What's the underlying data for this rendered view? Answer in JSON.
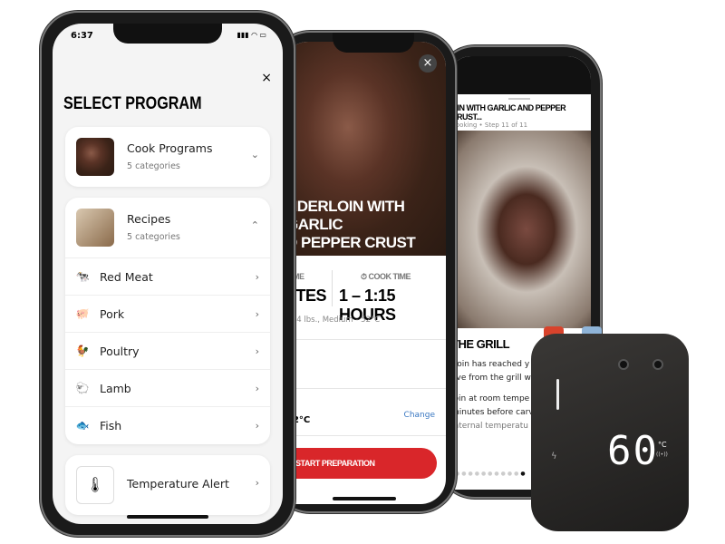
{
  "left_phone": {
    "status_time": "6:37",
    "status_icons": "▮▮▮ ◠ ▭",
    "close": "×",
    "title": "SELECT PROGRAM",
    "cook_programs": {
      "title": "Cook Programs",
      "subtitle": "5 categories"
    },
    "recipes": {
      "title": "Recipes",
      "subtitle": "5 categories",
      "items": [
        {
          "label": "Red Meat",
          "icon": "cow-icon"
        },
        {
          "label": "Pork",
          "icon": "pig-icon"
        },
        {
          "label": "Poultry",
          "icon": "chicken-icon"
        },
        {
          "label": "Lamb",
          "icon": "lamb-icon"
        },
        {
          "label": "Fish",
          "icon": "fish-icon"
        }
      ]
    },
    "temperature_alert": {
      "title": "Temperature Alert"
    }
  },
  "middle_phone": {
    "close": "×",
    "recipe_title_line1": "NDERLOIN WITH GARLIC",
    "recipe_title_line2": "D PEPPER CRUST",
    "prep_label": "TIME",
    "prep_value": "UTES",
    "cook_label": "COOK TIME",
    "cook_value": "1 – 1:15 HOURS",
    "details": "½-4 lbs., Medium -  52°C",
    "target_temp": "52°C",
    "change_link": "Change",
    "start_button": "START PREPARATION",
    "accent": "#d9262a",
    "link_color": "#3a78c2"
  },
  "right_phone": {
    "header_title": "OIN WITH GARLIC AND PEPPER CRUST...",
    "header_sub": "Cooking • Step 11 of 11",
    "step_title": "THE GRILL",
    "step_text1": "rloin has reached y",
    "step_text2": "ove from the grill wi",
    "step_text3": "loin at room tempe",
    "step_text4": "minutes before carv",
    "step_text5": "internal temperatu"
  },
  "device": {
    "temperature": "60",
    "unit": "°C",
    "wireless": "((•))"
  }
}
